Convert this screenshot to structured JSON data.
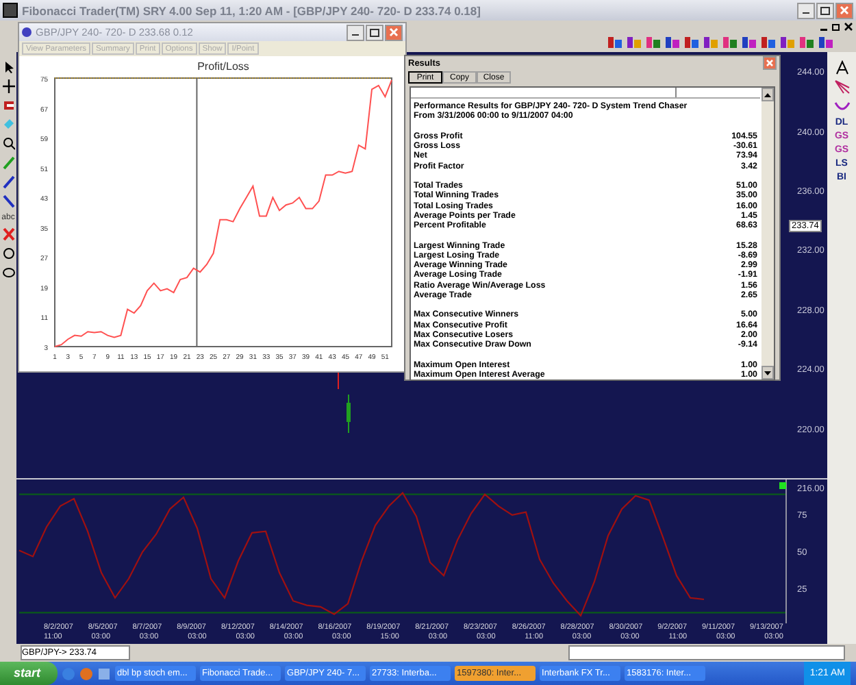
{
  "window": {
    "title": "Fibonacci Trader(TM) SRY 4.00 Sep 11,  1:20 AM - [GBP/JPY 240- 720- D 233.74 0.18]"
  },
  "right_tools": [
    "DL",
    "GS",
    "GS",
    "LS",
    "BI"
  ],
  "left_tools": {
    "text_tool": "abc"
  },
  "price_axis": {
    "labels": [
      "244.00",
      "240.00",
      "236.00",
      "232.00",
      "228.00",
      "224.00",
      "220.00",
      "216.00"
    ],
    "current": "233.74"
  },
  "oscillator": {
    "chart_data": {
      "type": "line",
      "categories": [
        null,
        null,
        null,
        null,
        null,
        null,
        null,
        null,
        null,
        null,
        null,
        null,
        null,
        null,
        null,
        null,
        null,
        null,
        null,
        null,
        null,
        null,
        null,
        null,
        null,
        null,
        null,
        null,
        null,
        null,
        null,
        null,
        null,
        null,
        null,
        null,
        null,
        null,
        null,
        null,
        null,
        null,
        null,
        null,
        null,
        null,
        null,
        null,
        null,
        null,
        null,
        null,
        null,
        null,
        null,
        null,
        null
      ],
      "series": [
        {
          "color": "#a01010",
          "values": [
            52,
            48,
            68,
            82,
            87,
            65,
            37,
            20,
            33,
            51,
            63,
            80,
            88,
            67,
            33,
            20,
            45,
            64,
            65,
            37,
            18,
            15,
            14,
            9,
            16,
            45,
            69,
            82,
            91,
            75,
            44,
            35,
            59,
            77,
            90,
            82,
            76,
            78,
            46,
            30,
            18,
            8,
            31,
            62,
            80,
            89,
            86,
            61,
            35,
            20,
            19,
            null,
            null,
            null,
            null,
            null,
            null
          ]
        }
      ],
      "ylim": [
        0,
        100
      ],
      "yticks": [
        25,
        50,
        75
      ],
      "ref_lines": [
        {
          "axis": "y",
          "value": 90
        },
        {
          "axis": "y",
          "value": 10
        }
      ]
    }
  },
  "time_axis": {
    "dates": [
      "8/2/2007",
      "8/5/2007",
      "8/7/2007",
      "8/9/2007",
      "8/12/2007",
      "8/14/2007",
      "8/16/2007",
      "8/19/2007",
      "8/21/2007",
      "8/23/2007",
      "8/26/2007",
      "8/28/2007",
      "8/30/2007",
      "9/2/2007",
      "9/11/2007",
      "9/13/2007"
    ],
    "times": [
      "11:00",
      "03:00",
      "03:00",
      "03:00",
      "03:00",
      "03:00",
      "03:00",
      "15:00",
      "03:00",
      "03:00",
      "11:00",
      "03:00",
      "03:00",
      "11:00",
      "03:00",
      "03:00"
    ]
  },
  "summary_window": {
    "title": "GBP/JPY 240- 720- D 233.68 0.12",
    "buttons": [
      {
        "label": "View Parameters",
        "disabled": true
      },
      {
        "label": "Summary",
        "disabled": true
      },
      {
        "label": "Print",
        "disabled": true
      },
      {
        "label": "Options",
        "disabled": true
      },
      {
        "label": "Show",
        "disabled": true
      },
      {
        "label": "I/Point",
        "disabled": true
      }
    ],
    "chart_data": {
      "type": "line",
      "title": "Profit/Loss",
      "x": [
        1,
        2,
        3,
        4,
        5,
        6,
        7,
        8,
        9,
        10,
        11,
        12,
        13,
        14,
        15,
        16,
        17,
        18,
        19,
        20,
        21,
        22,
        23,
        24,
        25,
        26,
        27,
        28,
        29,
        30,
        31,
        32,
        33,
        34,
        35,
        36,
        37,
        38,
        39,
        40,
        41,
        42,
        43,
        44,
        45,
        46,
        47,
        48,
        49,
        50,
        51,
        52
      ],
      "series": [
        {
          "color": "#ff5050",
          "values": [
            3,
            3.5,
            5,
            6,
            5.8,
            7,
            6.8,
            7,
            6,
            5.5,
            6,
            13,
            12,
            14,
            18,
            20,
            18,
            18.5,
            17.5,
            21,
            21.5,
            24,
            23,
            25,
            28,
            37,
            37,
            36.5,
            40,
            43,
            46,
            38,
            38,
            43,
            39.5,
            41,
            41.5,
            43,
            40,
            40,
            42,
            49,
            49,
            50,
            49.5,
            50,
            57,
            56,
            72,
            73,
            70,
            74.5
          ]
        }
      ],
      "xlim": [
        1,
        52
      ],
      "ylim": [
        3,
        75
      ],
      "xticks": [
        1,
        3,
        5,
        7,
        9,
        11,
        13,
        15,
        17,
        19,
        21,
        23,
        25,
        27,
        29,
        31,
        33,
        35,
        37,
        39,
        41,
        43,
        45,
        47,
        49,
        51
      ],
      "yticks": [
        3,
        11,
        19,
        27,
        35,
        43,
        51,
        59,
        67,
        75
      ],
      "ref_lines": [
        {
          "axis": "x",
          "value": 22.5
        }
      ]
    }
  },
  "results_window": {
    "title": "Results",
    "buttons": [
      {
        "label": "Print",
        "selected": true
      },
      {
        "label": "Copy",
        "selected": false
      },
      {
        "label": "Close",
        "selected": false
      }
    ],
    "header": [
      "Performance Results for GBP/JPY  240-  720- D System Trend Chaser",
      "From 3/31/2006 00:00 to 9/11/2007 04:00"
    ],
    "groups": [
      [
        {
          "label": "Gross Profit",
          "value": "104.55"
        },
        {
          "label": "Gross Loss",
          "value": "-30.61"
        },
        {
          "label": "Net",
          "value": "73.94"
        },
        {
          "label": "Profit Factor",
          "value": "3.42"
        }
      ],
      [
        {
          "label": "Total Trades",
          "value": "51.00"
        },
        {
          "label": "Total Winning Trades",
          "value": "35.00"
        },
        {
          "label": "Total Losing Trades",
          "value": "16.00"
        },
        {
          "label": "Average Points per Trade",
          "value": "1.45"
        },
        {
          "label": "Percent Profitable",
          "value": "68.63"
        }
      ],
      [
        {
          "label": "Largest Winning Trade",
          "value": "15.28"
        },
        {
          "label": "Largest Losing Trade",
          "value": "-8.69"
        },
        {
          "label": "Average Winning Trade",
          "value": "2.99"
        },
        {
          "label": "Average Losing Trade",
          "value": "-1.91"
        },
        {
          "label": "Ratio Average Win/Average Loss",
          "value": "1.56"
        },
        {
          "label": "Average Trade",
          "value": "2.65"
        }
      ],
      [
        {
          "label": "Max Consecutive Winners",
          "value": "5.00"
        },
        {
          "label": "Max Consecutive Profit",
          "value": "16.64"
        },
        {
          "label": "Max Consecutive Losers",
          "value": "2.00"
        },
        {
          "label": "Max Consecutive Draw Down",
          "value": "-9.14"
        }
      ],
      [
        {
          "label": "Maximum Open Interest",
          "value": "1.00"
        },
        {
          "label": "Maximum Open Interest Average",
          "value": "1.00"
        }
      ]
    ]
  },
  "status_bar": {
    "symbol": "GBP/JPY->  233.74"
  },
  "taskbar": {
    "start": "start",
    "items": [
      {
        "label": "dbl bp stoch em...",
        "selected": false
      },
      {
        "label": "Fibonacci Trade...",
        "selected": false
      },
      {
        "label": "GBP/JPY 240- 7...",
        "selected": false
      },
      {
        "label": "27733: Interba...",
        "selected": false
      },
      {
        "label": "1597380: Inter...",
        "selected": true
      },
      {
        "label": "Interbank FX Tr...",
        "selected": false
      },
      {
        "label": "1583176: Inter...",
        "selected": false
      }
    ],
    "clock": "1:21 AM"
  }
}
